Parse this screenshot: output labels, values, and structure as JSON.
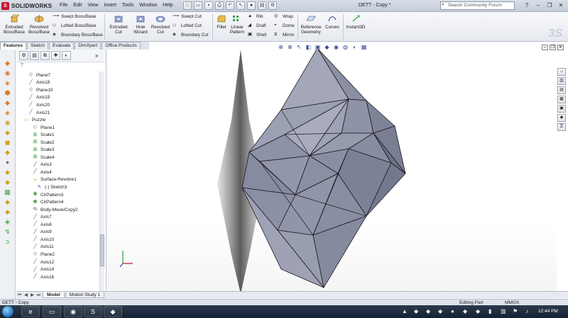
{
  "app": {
    "brand": "SOLIDWORKS",
    "doc_title": "DETT - Copy *"
  },
  "menu": [
    "File",
    "Edit",
    "View",
    "Insert",
    "Tools",
    "Window",
    "Help"
  ],
  "search": {
    "placeholder": "Search Community Forum"
  },
  "ribbon": {
    "extruded_boss": "Extruded Boss/Base",
    "revolved_boss": "Revolved Boss/Base",
    "swept_boss": "Swept Boss/Base",
    "lofted_boss": "Lofted Boss/Base",
    "boundary_boss": "Boundary Boss/Base",
    "extruded_cut": "Extruded Cut",
    "hole_wizard": "Hole Wizard",
    "revolved_cut": "Revolved Cut",
    "swept_cut": "Swept Cut",
    "lofted_cut": "Lofted Cut",
    "boundary_cut": "Boundary Cut",
    "fillet": "Fillet",
    "linear_pattern": "Linear Pattern",
    "rib": "Rib",
    "draft": "Draft",
    "shell": "Shell",
    "wrap": "Wrap",
    "dome": "Dome",
    "mirror": "Mirror",
    "reference_geometry": "Reference Geometry",
    "curves": "Curves",
    "instant3d": "Instant3D"
  },
  "tabs": [
    "Features",
    "Sketch",
    "Evaluate",
    "DimXpert",
    "Office Products"
  ],
  "tree": [
    {
      "label": "Plane7",
      "icon": "plane-icon",
      "indent": 1
    },
    {
      "label": "Axis18",
      "icon": "axis-icon",
      "indent": 1
    },
    {
      "label": "Plane10",
      "icon": "plane-icon",
      "indent": 1
    },
    {
      "label": "Axis19",
      "icon": "axis-icon",
      "indent": 1
    },
    {
      "label": "Axis20",
      "icon": "axis-icon",
      "indent": 1
    },
    {
      "label": "Axis21",
      "icon": "axis-icon",
      "indent": 1
    },
    {
      "label": "Puzzle",
      "icon": "folder-icon",
      "indent": 0
    },
    {
      "label": "Plane1",
      "icon": "plane-icon",
      "indent": 2
    },
    {
      "label": "Scale1",
      "icon": "scale-icon",
      "indent": 2
    },
    {
      "label": "Scale2",
      "icon": "scale-icon",
      "indent": 2
    },
    {
      "label": "Scale3",
      "icon": "scale-icon",
      "indent": 2
    },
    {
      "label": "Scale4",
      "icon": "scale-icon",
      "indent": 2
    },
    {
      "label": "Axis3",
      "icon": "axis-icon",
      "indent": 2
    },
    {
      "label": "Axis4",
      "icon": "axis-icon",
      "indent": 2
    },
    {
      "label": "Surface-Revolve1",
      "icon": "surface-revolve-icon",
      "indent": 2
    },
    {
      "label": "(-) Sketch3",
      "icon": "sketch-icon",
      "indent": 3
    },
    {
      "label": "CirPattern3",
      "icon": "circular-pattern-icon",
      "indent": 2
    },
    {
      "label": "CirPattern4",
      "icon": "circular-pattern-icon",
      "indent": 2
    },
    {
      "label": "Body-Move/Copy2",
      "icon": "move-copy-icon",
      "indent": 2
    },
    {
      "label": "Axis7",
      "icon": "axis-icon",
      "indent": 2
    },
    {
      "label": "Axis8",
      "icon": "axis-icon",
      "indent": 2
    },
    {
      "label": "Axis9",
      "icon": "axis-icon",
      "indent": 2
    },
    {
      "label": "Axis10",
      "icon": "axis-icon",
      "indent": 2
    },
    {
      "label": "Axis11",
      "icon": "axis-icon",
      "indent": 2
    },
    {
      "label": "Plane2",
      "icon": "plane-icon",
      "indent": 2
    },
    {
      "label": "Axis12",
      "icon": "axis-icon",
      "indent": 2
    },
    {
      "label": "Axis14",
      "icon": "axis-icon",
      "indent": 2
    },
    {
      "label": "Axis16",
      "icon": "axis-icon",
      "indent": 2
    }
  ],
  "bottom_tabs": [
    "Model",
    "Motion Study 1"
  ],
  "status": {
    "left": "DETT - Copy",
    "mode": "Editing Part",
    "units": "MMGS"
  },
  "taskbar": {
    "time": "12:44 PM"
  },
  "colors": {
    "model_face": "#8d91a6",
    "model_light": "#a9adbf",
    "model_dark": "#6f7388",
    "edge": "#1b1b22",
    "accent": "#c8102e"
  }
}
